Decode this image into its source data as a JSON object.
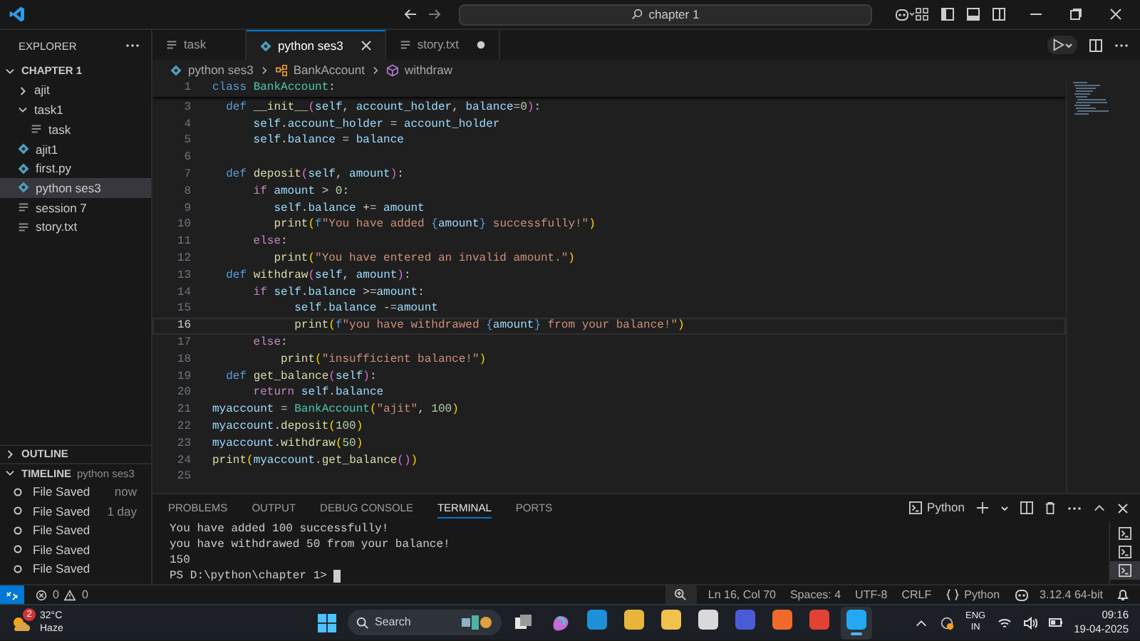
{
  "title_bar": {
    "search": "chapter 1"
  },
  "sidebar": {
    "title": "EXPLORER",
    "tree": {
      "label": "CHAPTER 1",
      "expanded": true,
      "children": [
        {
          "label": "ajit",
          "kind": "folder",
          "expanded": false,
          "selected": false
        },
        {
          "label": "task1",
          "kind": "folder",
          "expanded": true,
          "selected": false,
          "children": [
            {
              "label": "task",
              "kind": "text",
              "selected": false
            }
          ]
        },
        {
          "label": "ajit1",
          "kind": "python",
          "selected": false
        },
        {
          "label": "first.py",
          "kind": "python",
          "selected": false
        },
        {
          "label": "python ses3",
          "kind": "python",
          "selected": true
        },
        {
          "label": "session 7",
          "kind": "text",
          "selected": false
        },
        {
          "label": "story.txt",
          "kind": "text",
          "selected": false
        }
      ]
    },
    "outline": {
      "label": "OUTLINE",
      "expanded": false
    },
    "timeline": {
      "label": "TIMELINE",
      "file": "python ses3",
      "expanded": true,
      "entries": [
        {
          "label": "File Saved",
          "time": "now"
        },
        {
          "label": "File Saved",
          "time": "1 day"
        },
        {
          "label": "File Saved"
        },
        {
          "label": "File Saved"
        },
        {
          "label": "File Saved"
        }
      ]
    }
  },
  "tabs": [
    {
      "label": "task",
      "kind": "text",
      "selected": false,
      "dirty": false
    },
    {
      "label": "python ses3",
      "kind": "python",
      "selected": true,
      "dirty": false
    },
    {
      "label": "story.txt",
      "kind": "text",
      "selected": false,
      "dirty": true
    }
  ],
  "breadcrumb": [
    {
      "label": "python ses3",
      "kind": "python"
    },
    {
      "label": "BankAccount",
      "kind": "class"
    },
    {
      "label": "withdraw",
      "kind": "method"
    }
  ],
  "editor": {
    "sticky": {
      "number": "1",
      "tokens": [
        {
          "text": "class",
          "kind": "kw"
        },
        {
          "text": " BankAccount",
          "kind": "cls"
        },
        {
          "text": ":",
          "kind": "p"
        }
      ]
    },
    "lines": [
      {
        "number": "3",
        "current": false,
        "tokens": [
          {
            "text": "  def",
            "kind": "kw"
          },
          {
            "text": " __init__",
            "kind": "fn"
          },
          {
            "text": "(",
            "kind": "b2"
          },
          {
            "text": "self",
            "kind": "v"
          },
          {
            "text": ", ",
            "kind": "p"
          },
          {
            "text": "account_holder",
            "kind": "v"
          },
          {
            "text": ", ",
            "kind": "p"
          },
          {
            "text": "balance",
            "kind": "v"
          },
          {
            "text": "=",
            "kind": "p"
          },
          {
            "text": "0",
            "kind": "n"
          },
          {
            "text": ")",
            "kind": "b2"
          },
          {
            "text": ":",
            "kind": "p"
          }
        ]
      },
      {
        "number": "4",
        "current": false,
        "tokens": [
          {
            "text": "      self",
            "kind": "v"
          },
          {
            "text": ".",
            "kind": "p"
          },
          {
            "text": "account_holder",
            "kind": "v"
          },
          {
            "text": " = ",
            "kind": "p"
          },
          {
            "text": "account_holder",
            "kind": "v"
          }
        ]
      },
      {
        "number": "5",
        "current": false,
        "tokens": [
          {
            "text": "      self",
            "kind": "v"
          },
          {
            "text": ".",
            "kind": "p"
          },
          {
            "text": "balance",
            "kind": "v"
          },
          {
            "text": " = ",
            "kind": "p"
          },
          {
            "text": "balance",
            "kind": "v"
          }
        ]
      },
      {
        "number": "6",
        "current": false
      },
      {
        "number": "7",
        "current": false,
        "tokens": [
          {
            "text": "  def",
            "kind": "kw"
          },
          {
            "text": " deposit",
            "kind": "fn"
          },
          {
            "text": "(",
            "kind": "b2"
          },
          {
            "text": "self",
            "kind": "v"
          },
          {
            "text": ", ",
            "kind": "p"
          },
          {
            "text": "amount",
            "kind": "v"
          },
          {
            "text": ")",
            "kind": "b2"
          },
          {
            "text": ":",
            "kind": "p"
          }
        ]
      },
      {
        "number": "8",
        "current": false,
        "tokens": [
          {
            "text": "      if",
            "kind": "ctl"
          },
          {
            "text": " amount",
            "kind": "v"
          },
          {
            "text": " > ",
            "kind": "p"
          },
          {
            "text": "0",
            "kind": "n"
          },
          {
            "text": ":",
            "kind": "p"
          }
        ]
      },
      {
        "number": "9",
        "current": false,
        "tokens": [
          {
            "text": "         self",
            "kind": "v"
          },
          {
            "text": ".",
            "kind": "p"
          },
          {
            "text": "balance",
            "kind": "v"
          },
          {
            "text": " += ",
            "kind": "p"
          },
          {
            "text": "amount",
            "kind": "v"
          }
        ]
      },
      {
        "number": "10",
        "current": false,
        "tokens": [
          {
            "text": "         print",
            "kind": "fn"
          },
          {
            "text": "(",
            "kind": "b1"
          },
          {
            "text": "f",
            "kind": "kw"
          },
          {
            "text": "\"You have added ",
            "kind": "s"
          },
          {
            "text": "{",
            "kind": "kw"
          },
          {
            "text": "amount",
            "kind": "v"
          },
          {
            "text": "}",
            "kind": "kw"
          },
          {
            "text": " successfully!\"",
            "kind": "s"
          },
          {
            "text": ")",
            "kind": "b1"
          }
        ]
      },
      {
        "number": "11",
        "current": false,
        "tokens": [
          {
            "text": "      else",
            "kind": "ctl"
          },
          {
            "text": ":",
            "kind": "p"
          }
        ]
      },
      {
        "number": "12",
        "current": false,
        "tokens": [
          {
            "text": "         print",
            "kind": "fn"
          },
          {
            "text": "(",
            "kind": "b1"
          },
          {
            "text": "\"You have entered an invalid amount.\"",
            "kind": "s"
          },
          {
            "text": ")",
            "kind": "b1"
          }
        ]
      },
      {
        "number": "13",
        "current": false,
        "tokens": [
          {
            "text": "  def",
            "kind": "kw"
          },
          {
            "text": " withdraw",
            "kind": "fn"
          },
          {
            "text": "(",
            "kind": "b2"
          },
          {
            "text": "self",
            "kind": "v"
          },
          {
            "text": ", ",
            "kind": "p"
          },
          {
            "text": "amount",
            "kind": "v"
          },
          {
            "text": ")",
            "kind": "b2"
          },
          {
            "text": ":",
            "kind": "p"
          }
        ]
      },
      {
        "number": "14",
        "current": false,
        "tokens": [
          {
            "text": "      if",
            "kind": "ctl"
          },
          {
            "text": " self",
            "kind": "v"
          },
          {
            "text": ".",
            "kind": "p"
          },
          {
            "text": "balance",
            "kind": "v"
          },
          {
            "text": " >=",
            "kind": "p"
          },
          {
            "text": "amount",
            "kind": "v"
          },
          {
            "text": ":",
            "kind": "p"
          }
        ]
      },
      {
        "number": "15",
        "current": false,
        "tokens": [
          {
            "text": "            self",
            "kind": "v"
          },
          {
            "text": ".",
            "kind": "p"
          },
          {
            "text": "balance",
            "kind": "v"
          },
          {
            "text": " -=",
            "kind": "p"
          },
          {
            "text": "amount",
            "kind": "v"
          }
        ]
      },
      {
        "number": "16",
        "current": true,
        "tokens": [
          {
            "text": "            print",
            "kind": "fn"
          },
          {
            "text": "(",
            "kind": "b1"
          },
          {
            "text": "f",
            "kind": "kw"
          },
          {
            "text": "\"you have withdrawed ",
            "kind": "s"
          },
          {
            "text": "{",
            "kind": "kw"
          },
          {
            "text": "amount",
            "kind": "v"
          },
          {
            "text": "}",
            "kind": "kw"
          },
          {
            "text": " from your balance!\"",
            "kind": "s"
          },
          {
            "text": ")",
            "kind": "b1"
          }
        ]
      },
      {
        "number": "17",
        "current": false,
        "tokens": [
          {
            "text": "      else",
            "kind": "ctl"
          },
          {
            "text": ":",
            "kind": "p"
          }
        ]
      },
      {
        "number": "18",
        "current": false,
        "tokens": [
          {
            "text": "          print",
            "kind": "fn"
          },
          {
            "text": "(",
            "kind": "b1"
          },
          {
            "text": "\"insufficient balance!\"",
            "kind": "s"
          },
          {
            "text": ")",
            "kind": "b1"
          }
        ]
      },
      {
        "number": "19",
        "current": false,
        "tokens": [
          {
            "text": "  def",
            "kind": "kw"
          },
          {
            "text": " get_balance",
            "kind": "fn"
          },
          {
            "text": "(",
            "kind": "b2"
          },
          {
            "text": "self",
            "kind": "v"
          },
          {
            "text": ")",
            "kind": "b2"
          },
          {
            "text": ":",
            "kind": "p"
          }
        ]
      },
      {
        "number": "20",
        "current": false,
        "tokens": [
          {
            "text": "      return",
            "kind": "ctl"
          },
          {
            "text": " self",
            "kind": "v"
          },
          {
            "text": ".",
            "kind": "p"
          },
          {
            "text": "balance",
            "kind": "v"
          }
        ]
      },
      {
        "number": "21",
        "current": false,
        "tokens": [
          {
            "text": "myaccount",
            "kind": "v"
          },
          {
            "text": " = ",
            "kind": "p"
          },
          {
            "text": "BankAccount",
            "kind": "cls"
          },
          {
            "text": "(",
            "kind": "b1"
          },
          {
            "text": "\"ajit\"",
            "kind": "s"
          },
          {
            "text": ", ",
            "kind": "p"
          },
          {
            "text": "100",
            "kind": "n"
          },
          {
            "text": ")",
            "kind": "b1"
          }
        ]
      },
      {
        "number": "22",
        "current": false,
        "tokens": [
          {
            "text": "myaccount",
            "kind": "v"
          },
          {
            "text": ".",
            "kind": "p"
          },
          {
            "text": "deposit",
            "kind": "fn"
          },
          {
            "text": "(",
            "kind": "b1"
          },
          {
            "text": "100",
            "kind": "n"
          },
          {
            "text": ")",
            "kind": "b1"
          }
        ]
      },
      {
        "number": "23",
        "current": false,
        "tokens": [
          {
            "text": "myaccount",
            "kind": "v"
          },
          {
            "text": ".",
            "kind": "p"
          },
          {
            "text": "withdraw",
            "kind": "fn"
          },
          {
            "text": "(",
            "kind": "b1"
          },
          {
            "text": "50",
            "kind": "n"
          },
          {
            "text": ")",
            "kind": "b1"
          }
        ]
      },
      {
        "number": "24",
        "current": false,
        "tokens": [
          {
            "text": "print",
            "kind": "fn"
          },
          {
            "text": "(",
            "kind": "b1"
          },
          {
            "text": "myaccount",
            "kind": "v"
          },
          {
            "text": ".",
            "kind": "p"
          },
          {
            "text": "get_balance",
            "kind": "fn"
          },
          {
            "text": "(",
            "kind": "b2"
          },
          {
            "text": ")",
            "kind": "b2"
          },
          {
            "text": ")",
            "kind": "b1"
          }
        ]
      },
      {
        "number": "25",
        "current": false
      }
    ]
  },
  "panel": {
    "tabs": [
      {
        "label": "PROBLEMS",
        "selected": false
      },
      {
        "label": "OUTPUT",
        "selected": false
      },
      {
        "label": "DEBUG CONSOLE",
        "selected": false
      },
      {
        "label": "TERMINAL",
        "selected": true
      },
      {
        "label": "PORTS",
        "selected": false
      }
    ],
    "shell": "Python",
    "output": [
      "You have added 100 successfully!",
      "you have withdrawed 50 from your balance!",
      "150"
    ],
    "prompt": "PS D:\\python\\chapter 1>",
    "terminals": [
      {
        "selected": false
      },
      {
        "selected": false
      },
      {
        "selected": true
      }
    ]
  },
  "status_bar": {
    "errors": "0",
    "warnings": "0",
    "items": [
      "Ln 16, Col 70",
      "Spaces: 4",
      "UTF-8",
      "CRLF"
    ],
    "language": "Python",
    "interpreter": "3.12.4 64-bit"
  },
  "taskbar": {
    "weather": {
      "badge": "2",
      "temp": "32°C",
      "condition": "Haze"
    },
    "search": "Search",
    "apps": [
      {
        "color": "#1e90d8",
        "active": false
      },
      {
        "color": "#e8b53c",
        "active": false
      },
      {
        "color": "#f2c14e",
        "active": false
      },
      {
        "color": "#d9d9d9",
        "active": false
      },
      {
        "color": "#4b5bd6",
        "active": false
      },
      {
        "color": "#f06a2a",
        "active": false
      },
      {
        "color": "#e34133",
        "active": false
      },
      {
        "color": "#23a9f2",
        "active": true
      }
    ],
    "tray": {
      "lang": "ENG",
      "region": "IN",
      "time": "09:16",
      "date": "19-04-2025"
    }
  }
}
